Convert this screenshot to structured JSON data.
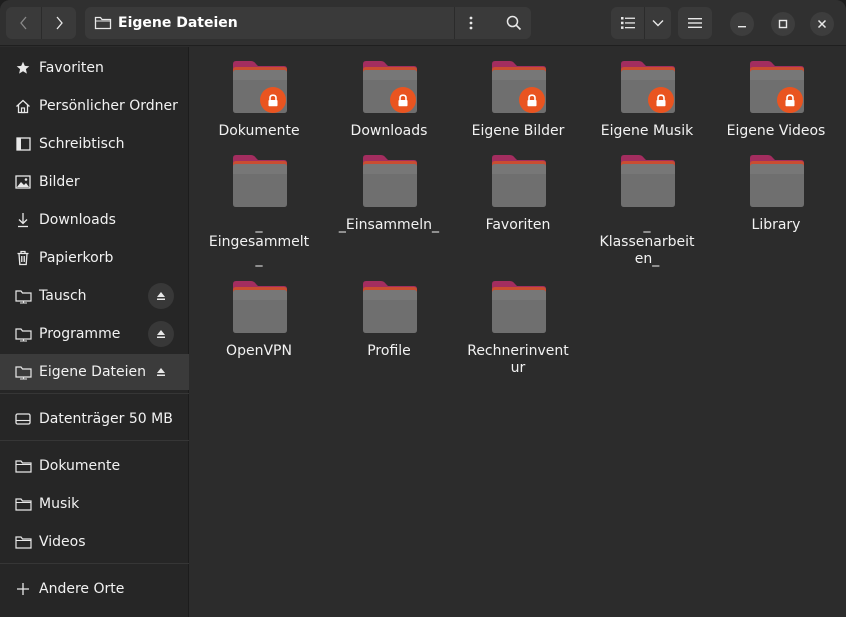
{
  "window": {
    "title": "Eigene Dateien",
    "colors": {
      "accent": "#e95420",
      "folder_top": "#a32d5f",
      "folder_body": "#6b6b6b"
    }
  },
  "header": {
    "back_icon": "chevron-left-icon",
    "forward_icon": "chevron-right-icon",
    "path_title": "Eigene Dateien",
    "path_icon": "folder-icon",
    "path_menu_icon": "vertical-dots-icon",
    "search_icon": "search-icon",
    "view_icon": "list-view-icon",
    "view_dropdown_icon": "chevron-down-icon",
    "menu_icon": "hamburger-icon",
    "minimize_icon": "minimize-icon",
    "maximize_icon": "maximize-icon",
    "close_icon": "close-icon"
  },
  "sidebar": {
    "items": [
      {
        "label": "Favoriten",
        "icon": "star-icon"
      },
      {
        "label": "Persönlicher Ordner",
        "icon": "home-icon"
      },
      {
        "label": "Schreibtisch",
        "icon": "desktop-icon"
      },
      {
        "label": "Bilder",
        "icon": "pictures-icon"
      },
      {
        "label": "Downloads",
        "icon": "download-icon"
      },
      {
        "label": "Papierkorb",
        "icon": "trash-icon"
      },
      {
        "label": "Tausch",
        "icon": "network-folder-icon",
        "eject": true
      },
      {
        "label": "Programme",
        "icon": "network-folder-icon",
        "eject": true
      },
      {
        "label": "Eigene Dateien",
        "icon": "network-folder-icon",
        "eject": true,
        "active": true
      },
      {
        "label": "Datenträger 50 MB",
        "icon": "drive-icon"
      },
      {
        "label": "Dokumente",
        "icon": "folder-icon"
      },
      {
        "label": "Musik",
        "icon": "folder-icon"
      },
      {
        "label": "Videos",
        "icon": "folder-icon"
      },
      {
        "label": "Andere Orte",
        "icon": "plus-icon"
      }
    ]
  },
  "files": [
    {
      "name": "Dokumente",
      "locked": true
    },
    {
      "name": "Downloads",
      "locked": true
    },
    {
      "name": "Eigene Bilder",
      "locked": true
    },
    {
      "name": "Eigene Musik",
      "locked": true
    },
    {
      "name": "Eigene Videos",
      "locked": true
    },
    {
      "name": "_\nEingesammelt\n_",
      "locked": false
    },
    {
      "name": "_Einsammeln_",
      "locked": false
    },
    {
      "name": "Favoriten",
      "locked": false
    },
    {
      "name": "_\nKlassenarbeit\nen_",
      "locked": false
    },
    {
      "name": "Library",
      "locked": false
    },
    {
      "name": "OpenVPN",
      "locked": false
    },
    {
      "name": "Profile",
      "locked": false
    },
    {
      "name": "Rechnerinvent\nur",
      "locked": false
    }
  ]
}
